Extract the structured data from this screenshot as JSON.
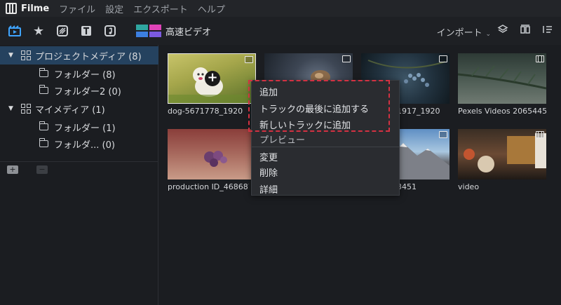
{
  "app": {
    "name": "Filme",
    "menu": [
      "ファイル",
      "設定",
      "エクスポート",
      "ヘルプ"
    ]
  },
  "toolbar": {
    "tools": [
      "media-icon",
      "effects-icon",
      "transition-icon",
      "text-icon",
      "music-icon"
    ],
    "speed_label": "高速ビデオ",
    "import_label": "インポート",
    "right_icons": [
      "layers-icon",
      "layout-icon",
      "list-icon"
    ],
    "colors": {
      "active": "#3fa4ff",
      "speed_green": "#2fa6a0",
      "speed_blue": "#3c7fe0",
      "speed_pink": "#e043b8"
    }
  },
  "sidebar": {
    "project_media": "プロジェクトメディア (8)",
    "project_folders": [
      "フォルダー (8)",
      "フォルダー2 (0)"
    ],
    "my_media": "マイメディア (1)",
    "my_folders": [
      "フォルダー (1)",
      "フォルダ... (0)"
    ]
  },
  "media": [
    {
      "label": "dog-5671778_1920",
      "type": "image"
    },
    {
      "label": "",
      "type": "image"
    },
    {
      "label": "1917_1920",
      "type": "image"
    },
    {
      "label": "Pexels Videos 2065445",
      "type": "video"
    },
    {
      "label": "production ID_4686879",
      "type": "image"
    },
    {
      "label": "",
      "type": "image"
    },
    {
      "label": "3451",
      "type": "image"
    },
    {
      "label": "video",
      "type": "video"
    }
  ],
  "context_menu": {
    "items": [
      "追加",
      "トラックの最後に追加する",
      "新しいトラックに追加",
      "プレビュー",
      "変更",
      "削除",
      "詳細"
    ]
  }
}
